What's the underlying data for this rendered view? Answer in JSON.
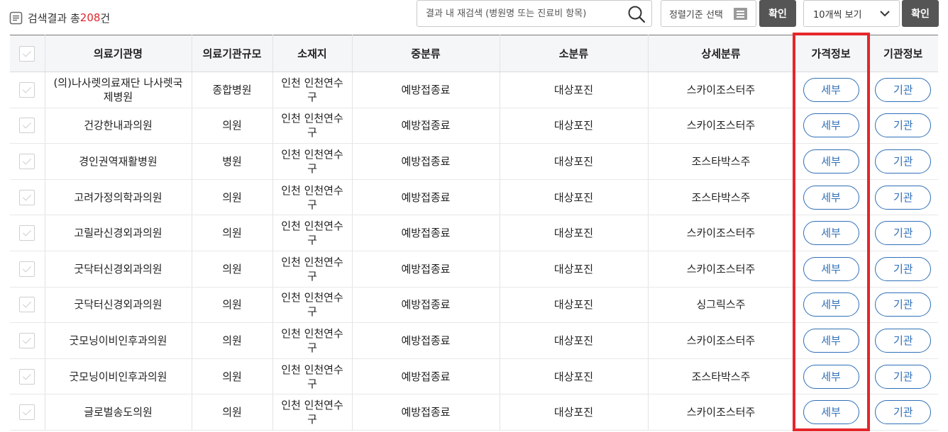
{
  "header": {
    "result_label": "검색결과 총",
    "result_count": "208",
    "result_suffix": "건"
  },
  "search": {
    "placeholder": "결과 내 재검색 (병원명 또는 진료비 항목)",
    "value": ""
  },
  "sort": {
    "label": "정렬기준 선택"
  },
  "confirm_label": "확인",
  "page_size": {
    "selected": "10개씩 보기"
  },
  "table": {
    "columns": [
      "의료기관명",
      "의료기관규모",
      "소재지",
      "중분류",
      "소분류",
      "상세분류",
      "가격정보",
      "기관정보"
    ],
    "rows": [
      {
        "name": "(의)나사렛의료재단 나사렛국제병원",
        "size": "종합병원",
        "location": "인천 인천연수구",
        "mid": "예방접종료",
        "small": "대상포진",
        "detail": "스카이조스터주",
        "price": "세부",
        "inst": "기관"
      },
      {
        "name": "건강한내과의원",
        "size": "의원",
        "location": "인천 인천연수구",
        "mid": "예방접종료",
        "small": "대상포진",
        "detail": "스카이조스터주",
        "price": "세부",
        "inst": "기관"
      },
      {
        "name": "경인권역재활병원",
        "size": "병원",
        "location": "인천 인천연수구",
        "mid": "예방접종료",
        "small": "대상포진",
        "detail": "조스타박스주",
        "price": "세부",
        "inst": "기관"
      },
      {
        "name": "고려가정의학과의원",
        "size": "의원",
        "location": "인천 인천연수구",
        "mid": "예방접종료",
        "small": "대상포진",
        "detail": "조스타박스주",
        "price": "세부",
        "inst": "기관"
      },
      {
        "name": "고릴라신경외과의원",
        "size": "의원",
        "location": "인천 인천연수구",
        "mid": "예방접종료",
        "small": "대상포진",
        "detail": "스카이조스터주",
        "price": "세부",
        "inst": "기관"
      },
      {
        "name": "굿닥터신경외과의원",
        "size": "의원",
        "location": "인천 인천연수구",
        "mid": "예방접종료",
        "small": "대상포진",
        "detail": "스카이조스터주",
        "price": "세부",
        "inst": "기관"
      },
      {
        "name": "굿닥터신경외과의원",
        "size": "의원",
        "location": "인천 인천연수구",
        "mid": "예방접종료",
        "small": "대상포진",
        "detail": "싱그릭스주",
        "price": "세부",
        "inst": "기관"
      },
      {
        "name": "굿모닝이비인후과의원",
        "size": "의원",
        "location": "인천 인천연수구",
        "mid": "예방접종료",
        "small": "대상포진",
        "detail": "스카이조스터주",
        "price": "세부",
        "inst": "기관"
      },
      {
        "name": "굿모닝이비인후과의원",
        "size": "의원",
        "location": "인천 인천연수구",
        "mid": "예방접종료",
        "small": "대상포진",
        "detail": "조스타박스주",
        "price": "세부",
        "inst": "기관"
      },
      {
        "name": "글로벌송도의원",
        "size": "의원",
        "location": "인천 인천연수구",
        "mid": "예방접종료",
        "small": "대상포진",
        "detail": "스카이조스터주",
        "price": "세부",
        "inst": "기관"
      }
    ]
  },
  "colors": {
    "accent_blue": "#2f6fb7",
    "count_red": "#e0262b",
    "highlight_red": "#e5262a",
    "button_dark": "#555555"
  },
  "icons": {
    "result": "document-icon",
    "search": "search-icon",
    "sort": "list-icon",
    "dropdown": "chevron-down-icon"
  }
}
